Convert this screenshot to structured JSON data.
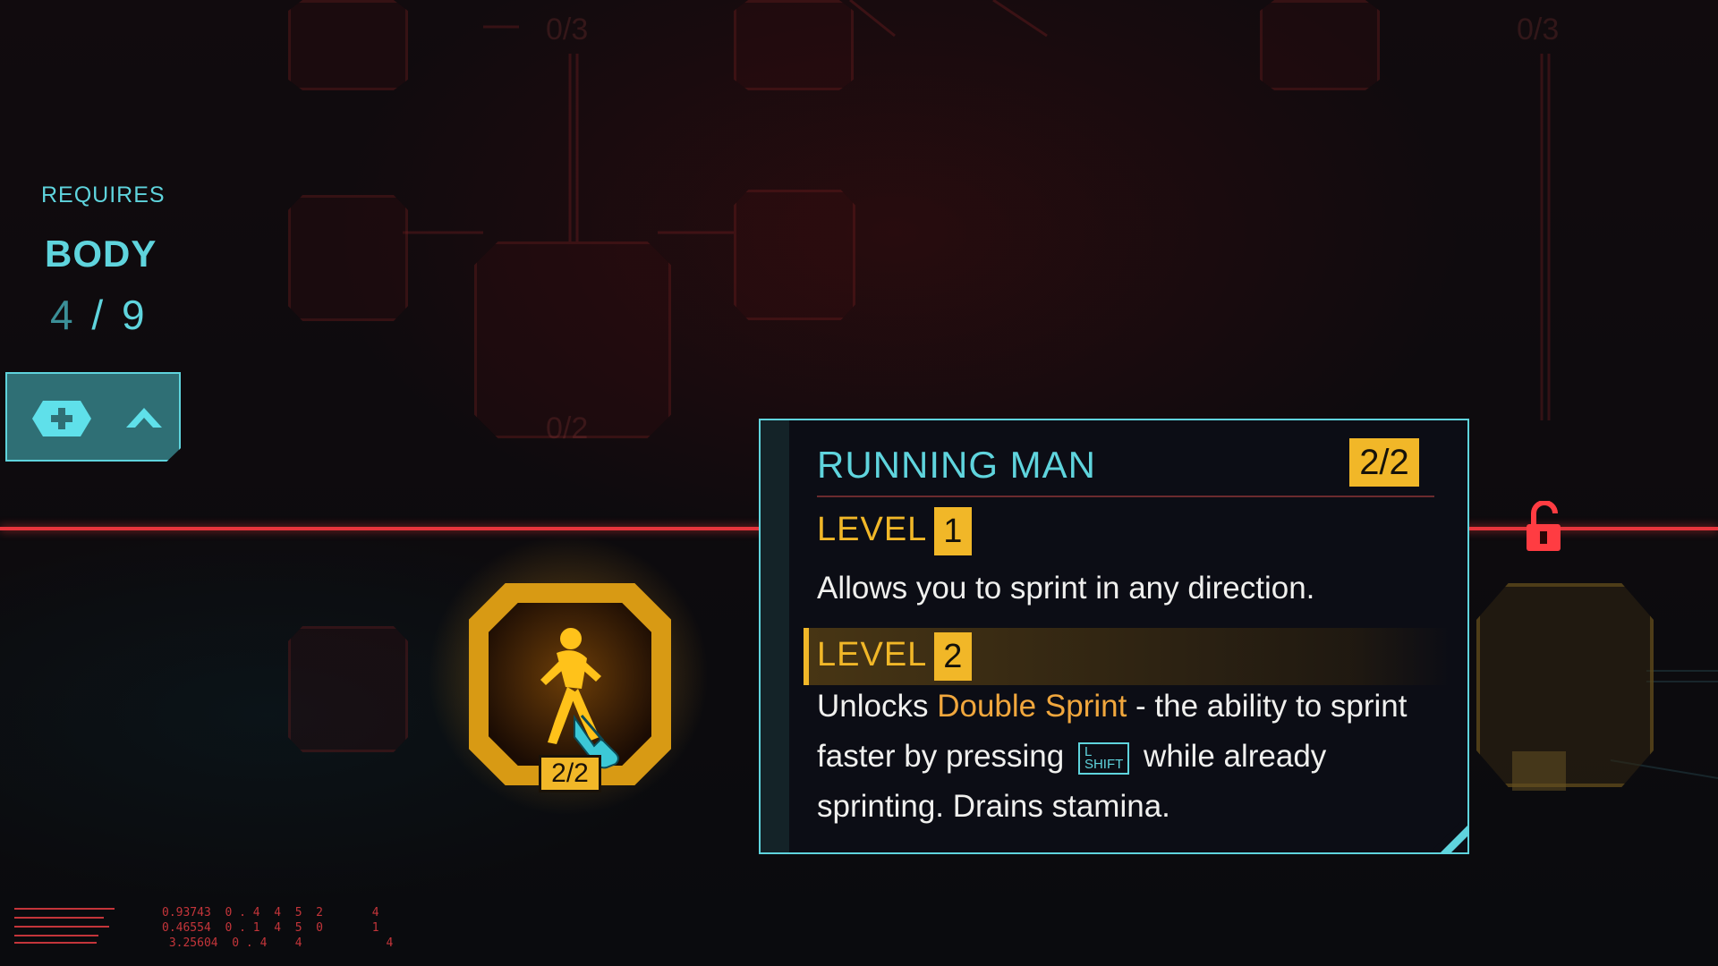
{
  "attribute": {
    "requires_label": "REQUIRES",
    "name": "BODY",
    "current": "4",
    "separator": " / ",
    "max": "9"
  },
  "perk": {
    "node_level": "2/2",
    "title": "RUNNING MAN",
    "level_badge": "2/2"
  },
  "levels": [
    {
      "label": "LEVEL",
      "number": "1",
      "description": "Allows you to sprint in any direction."
    },
    {
      "label": "LEVEL",
      "number": "2",
      "desc_before": "Unlocks ",
      "desc_highlight": "Double Sprint",
      "desc_mid": " - the ability to sprint faster by pressing ",
      "key_top": "L",
      "key_bottom": "SHIFT",
      "desc_after": " while already sprinting. Drains stamina."
    }
  ],
  "ghost_labels": [
    "0/3",
    "0/3",
    "0/2"
  ],
  "debug": {
    "nums": "0.93743  0 . 4  4  5  2       4\n0.46554  0 . 1  4  5  0       1\n 3.25604  0 . 4    4            4"
  },
  "colors": {
    "accent": "#5fd4dd",
    "gold": "#f1b728",
    "alert_red": "#e5353c",
    "highlight": "#f1a73d"
  },
  "icons": [
    "gamepad-plus-icon",
    "chevron-up-icon",
    "unlocked-padlock-icon",
    "running-man-icon",
    "hand-cursor-icon"
  ]
}
